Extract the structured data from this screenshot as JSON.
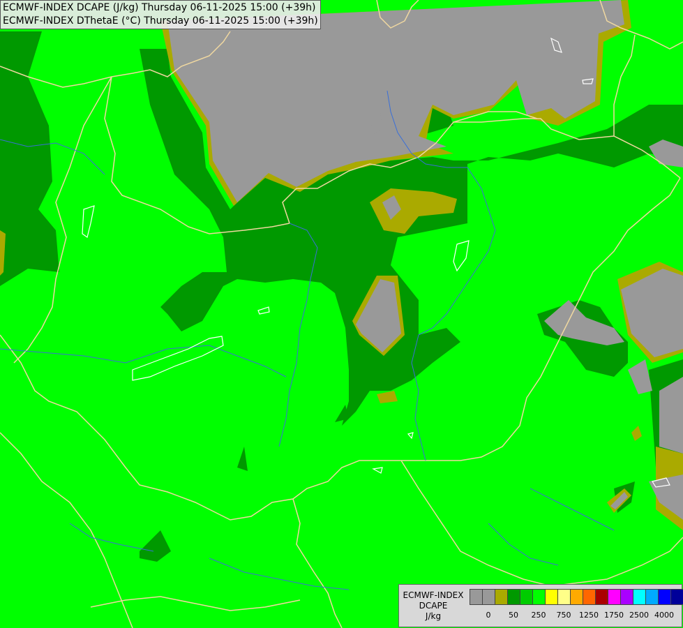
{
  "header": {
    "line1": "ECMWF-INDEX DCAPE (J/kg) Thursday 06-11-2025 15:00 (+39h)",
    "line2": "ECMWF-INDEX DThetaE (°C) Thursday 06-11-2025 15:00 (+39h)"
  },
  "legend": {
    "name": "ECMWF-INDEX",
    "variable": "DCAPE",
    "unit": "J/kg",
    "colors": [
      "#999999",
      "#999999",
      "#aaaa00",
      "#009900",
      "#00cc00",
      "#00ff00",
      "#ffff00",
      "#ffff88",
      "#ffaa00",
      "#ff6600",
      "#aa0000",
      "#ff00ff",
      "#aa00ff",
      "#00ffff",
      "#00aaff",
      "#0000ff",
      "#000099"
    ],
    "ticks": [
      "0",
      "50",
      "250",
      "750",
      "1250",
      "1750",
      "2500",
      "4000"
    ]
  },
  "map_colors": {
    "background": "#00ff00",
    "zero": "#999999",
    "low": "#aaaa00",
    "mid": "#009900",
    "border": "#f0d8a0",
    "river": "#3a6fd8",
    "coast": "#ffffff"
  }
}
